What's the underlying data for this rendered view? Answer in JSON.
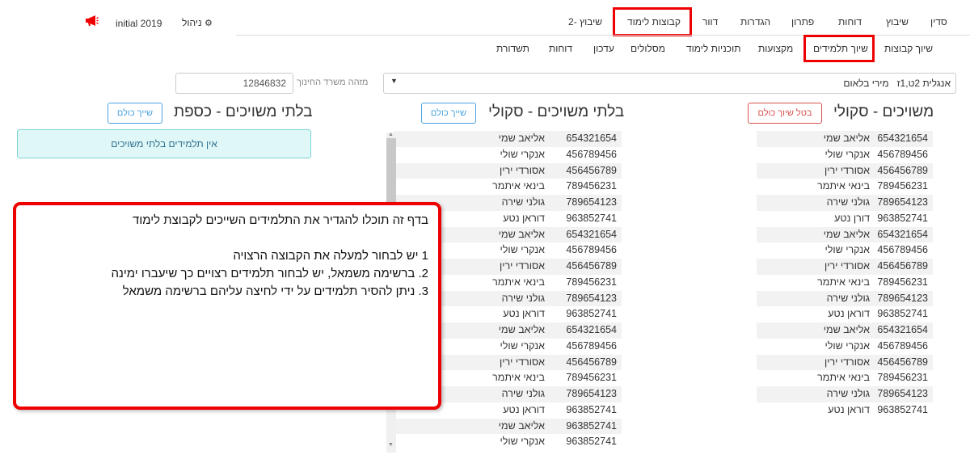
{
  "header": {
    "year_label": "initial 2019",
    "manage_label": "ניהול",
    "nav_tabs": [
      "סדין",
      "שיבוץ",
      "דוחות",
      "פתרון",
      "הגדרות",
      "דוור",
      "קבוצות לימוד",
      "שיבוץ -2"
    ],
    "sub_tabs": [
      "שיוך קבוצות",
      "שיוך תלמידים",
      "מקצועות",
      "תוכניות לימוד",
      "מסלולים",
      "עדכון",
      "דוחות",
      "תשדורת"
    ]
  },
  "filters": {
    "group_select_value": "אנגלית 2ט,1ז   מירי בלאום",
    "ministry_id_label": "מזהה משרד החינוך",
    "ministry_id_value": "12846832"
  },
  "panels": {
    "assigned_title": "משויכים - סקולי",
    "cancel_assign_all": "בטל שיוך כולם",
    "unassigned_school_title": "בלתי משויכים - סקולי",
    "assign_all_1": "שייך כולם",
    "unassigned_kaspat_title": "בלתי משויכים - כספת",
    "assign_all_2": "שייך כולם",
    "no_students_alert": "אין תלמידים בלתי משויכים"
  },
  "assigned_students": [
    {
      "id": "654321654",
      "name": "אליאב שמי"
    },
    {
      "id": "456789456",
      "name": "אנקרי שולי"
    },
    {
      "id": "456456789",
      "name": "אסורדי ירין"
    },
    {
      "id": "789456231",
      "name": "בינאי איתמר"
    },
    {
      "id": "789654123",
      "name": "גולני שירה"
    },
    {
      "id": "963852741",
      "name": "דורן נטע"
    },
    {
      "id": "654321654",
      "name": "אליאב שמי"
    },
    {
      "id": "456789456",
      "name": "אנקרי שולי"
    },
    {
      "id": "456456789",
      "name": "אסורדי ירין"
    },
    {
      "id": "789456231",
      "name": "בינאי איתמר"
    },
    {
      "id": "789654123",
      "name": "גולני שירה"
    },
    {
      "id": "963852741",
      "name": "דוראן נטע"
    },
    {
      "id": "654321654",
      "name": "אליאב שמי"
    },
    {
      "id": "456789456",
      "name": "אנקרי שולי"
    },
    {
      "id": "456456789",
      "name": "אסורדי ירין"
    },
    {
      "id": "789456231",
      "name": "בינאי איתמר"
    },
    {
      "id": "789654123",
      "name": "גולני שירה"
    },
    {
      "id": "963852741",
      "name": "דוראן נטע"
    }
  ],
  "unassigned_students": [
    {
      "id": "654321654",
      "name": "אליאב שמי"
    },
    {
      "id": "456789456",
      "name": "אנקרי שולי"
    },
    {
      "id": "456456789",
      "name": "אסורדי ירין"
    },
    {
      "id": "789456231",
      "name": "בינאי איתמר"
    },
    {
      "id": "789654123",
      "name": "גולני שירה"
    },
    {
      "id": "963852741",
      "name": "דוראן נטע"
    },
    {
      "id": "654321654",
      "name": "אליאב שמי"
    },
    {
      "id": "456789456",
      "name": "אנקרי שולי"
    },
    {
      "id": "456456789",
      "name": "אסורדי ירין"
    },
    {
      "id": "789456231",
      "name": "בינאי איתמר"
    },
    {
      "id": "789654123",
      "name": "גולני שירה"
    },
    {
      "id": "963852741",
      "name": "דוראן נטע"
    },
    {
      "id": "654321654",
      "name": "אליאב שמי"
    },
    {
      "id": "456789456",
      "name": "אנקרי שולי"
    },
    {
      "id": "456456789",
      "name": "אסורדי ירין"
    },
    {
      "id": "789456231",
      "name": "בינאי איתמר"
    },
    {
      "id": "789654123",
      "name": "גולני שירה"
    },
    {
      "id": "963852741",
      "name": "דוראן נטע"
    },
    {
      "id": "963852741",
      "name": "אליאב שמי"
    },
    {
      "id": "963852741",
      "name": "אנקרי שולי"
    }
  ],
  "callout": {
    "line1": "בדף זה תוכלו להגדיר את התלמידים השייכים לקבוצת לימוד",
    "line2": "1 יש לבחור למעלה את הקבוצה הרצויה",
    "line3": "2. ברשימה משמאל, יש לבחור תלמידים רצויים כך שיעברו ימינה",
    "line4": "3. ניתן להסיר תלמידים על ידי לחיצה עליהם ברשימה משמאל"
  },
  "colors": {
    "highlight": "#e00000",
    "accent": "#4aa3df",
    "danger": "#d9534f"
  }
}
